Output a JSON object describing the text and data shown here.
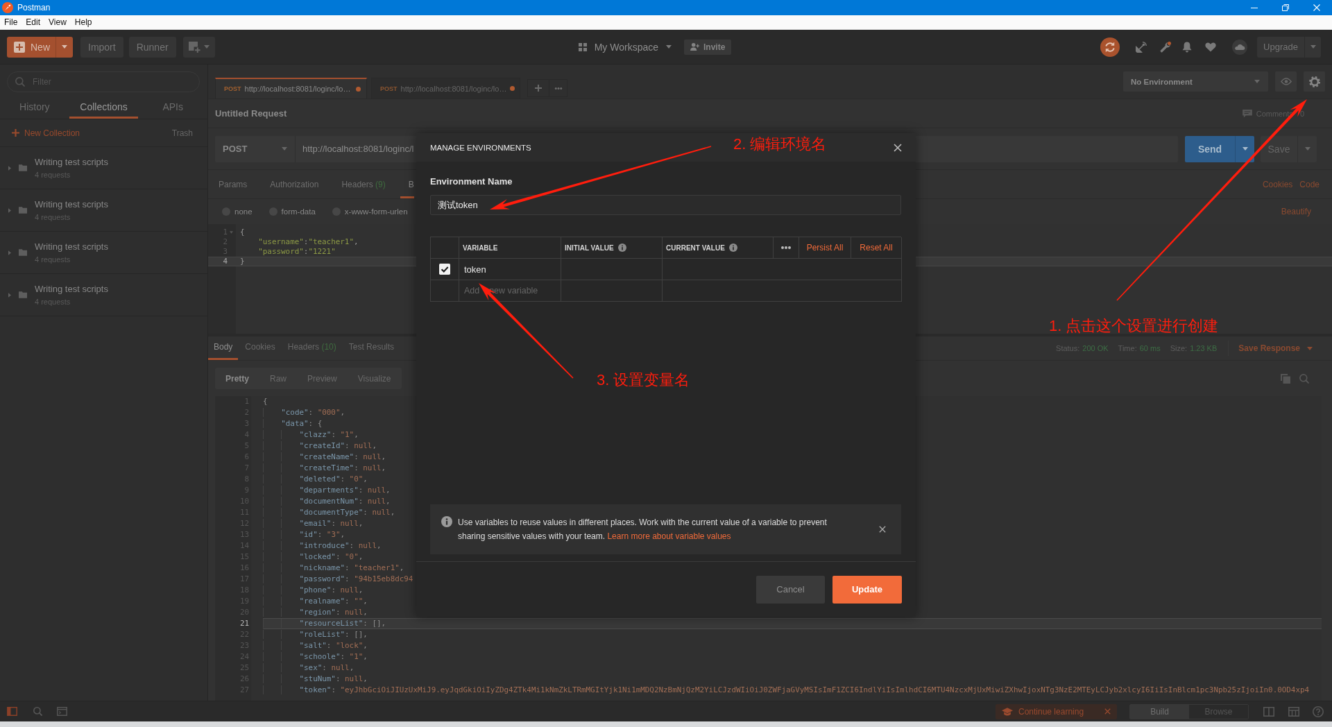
{
  "window": {
    "title": "Postman"
  },
  "menu": [
    {
      "label": "File"
    },
    {
      "label": "Edit"
    },
    {
      "label": "View"
    },
    {
      "label": "Help"
    }
  ],
  "toolbar": {
    "new": "New",
    "import": "Import",
    "runner": "Runner",
    "workspace": "My Workspace",
    "invite": "Invite",
    "upgrade": "Upgrade"
  },
  "sidebar": {
    "filter_placeholder": "Filter",
    "tabs": [
      {
        "label": "History",
        "selected": false
      },
      {
        "label": "Collections",
        "selected": true
      },
      {
        "label": "APIs",
        "selected": false
      }
    ],
    "new_collection": "New Collection",
    "trash": "Trash",
    "collections": [
      {
        "name": "Writing test scripts",
        "count": "4 requests"
      },
      {
        "name": "Writing test scripts",
        "count": "4 requests"
      },
      {
        "name": "Writing test scripts",
        "count": "4 requests"
      },
      {
        "name": "Writing test scripts",
        "count": "4 requests"
      }
    ]
  },
  "request_tabs": [
    {
      "method": "POST",
      "url": "http://localhost:8081/loginc/lo…",
      "unsaved": true,
      "selected": true
    },
    {
      "method": "POST",
      "url": "http://localhost:8081/loginc/lo…",
      "unsaved": true,
      "selected": false
    }
  ],
  "environment": {
    "value": "No Environment"
  },
  "request": {
    "title": "Untitled Request",
    "comments": "Comments",
    "comments_count": "0",
    "method": "POST",
    "url": "http://localhost:8081/loginc/l",
    "send": "Send",
    "save": "Save",
    "tabs": [
      {
        "label": "Params",
        "selected": false
      },
      {
        "label": "Authorization",
        "selected": false
      },
      {
        "label": "Headers",
        "count": "(9)",
        "selected": false
      },
      {
        "label": "B",
        "selected": true
      }
    ],
    "links": [
      {
        "label": "Cookies"
      },
      {
        "label": "Code"
      }
    ],
    "body_types": [
      {
        "label": "none",
        "selected": false
      },
      {
        "label": "form-data",
        "selected": false
      },
      {
        "label": "x-www-form-urlen",
        "selected": false
      }
    ],
    "beautify": "Beautify",
    "body_lines": [
      {
        "number": "1",
        "text": "{",
        "foldable": true,
        "selected": false
      },
      {
        "number": "2",
        "text": "    \"username\":\"teacher1\",",
        "foldable": false,
        "selected": false
      },
      {
        "number": "3",
        "text": "    \"password\":\"1221\"",
        "foldable": false,
        "selected": false
      },
      {
        "number": "4",
        "text": "}",
        "foldable": false,
        "selected": true
      }
    ]
  },
  "response": {
    "tabs": [
      {
        "label": "Body",
        "selected": true
      },
      {
        "label": "Cookies",
        "selected": false
      },
      {
        "label": "Headers",
        "count": "(10)",
        "selected": false
      },
      {
        "label": "Test Results",
        "selected": false
      }
    ],
    "status_label": "Status:",
    "status": "200 OK",
    "time_label": "Time:",
    "time": "60 ms",
    "size_label": "Size:",
    "size": "1.23 KB",
    "save_response": "Save Response",
    "views": [
      {
        "label": "Pretty",
        "selected": true
      },
      {
        "label": "Raw",
        "selected": false
      },
      {
        "label": "Preview",
        "selected": false
      },
      {
        "label": "Visualize",
        "selected": false
      }
    ],
    "lines": [
      {
        "number": "1",
        "text": "{",
        "selected": false
      },
      {
        "number": "2",
        "text": "    \"code\": \"000\",",
        "selected": false
      },
      {
        "number": "3",
        "text": "    \"data\": {",
        "selected": false
      },
      {
        "number": "4",
        "text": "        \"clazz\": \"1\",",
        "selected": false
      },
      {
        "number": "5",
        "text": "        \"createId\": null,",
        "selected": false
      },
      {
        "number": "6",
        "text": "        \"createName\": null,",
        "selected": false
      },
      {
        "number": "7",
        "text": "        \"createTime\": null,",
        "selected": false
      },
      {
        "number": "8",
        "text": "        \"deleted\": \"0\",",
        "selected": false
      },
      {
        "number": "9",
        "text": "        \"departments\": null,",
        "selected": false
      },
      {
        "number": "10",
        "text": "        \"documentNum\": null,",
        "selected": false
      },
      {
        "number": "11",
        "text": "        \"documentType\": null,",
        "selected": false
      },
      {
        "number": "12",
        "text": "        \"email\": null,",
        "selected": false
      },
      {
        "number": "13",
        "text": "        \"id\": \"3\",",
        "selected": false
      },
      {
        "number": "14",
        "text": "        \"introduce\": null,",
        "selected": false
      },
      {
        "number": "15",
        "text": "        \"locked\": \"0\",",
        "selected": false
      },
      {
        "number": "16",
        "text": "        \"nickname\": \"teacher1\",",
        "selected": false
      },
      {
        "number": "17",
        "text": "        \"password\": \"94b15eb8dc94",
        "selected": false
      },
      {
        "number": "18",
        "text": "        \"phone\": null,",
        "selected": false
      },
      {
        "number": "19",
        "text": "        \"realname\": \"\",",
        "selected": false
      },
      {
        "number": "20",
        "text": "        \"region\": null,",
        "selected": false
      },
      {
        "number": "21",
        "text": "        \"resourceList\": [],",
        "selected": true
      },
      {
        "number": "22",
        "text": "        \"roleList\": [],",
        "selected": false
      },
      {
        "number": "23",
        "text": "        \"salt\": \"lock\",",
        "selected": false
      },
      {
        "number": "24",
        "text": "        \"schoole\": \"1\",",
        "selected": false
      },
      {
        "number": "25",
        "text": "        \"sex\": null,",
        "selected": false
      },
      {
        "number": "26",
        "text": "        \"stuNum\": null,",
        "selected": false
      },
      {
        "number": "27",
        "text": "        \"token\": \"eyJhbGciOiJIUzUxMiJ9.eyJqdGkiOiIyZDg4ZTk4Mi1kNmZkLTRmMGItYjk1Ni1mMDQ2NzBmNjQzM2YiLCJzdWIiOiJ0ZWFjaGVyMSIsImF1ZCI6IndlYiIsImlhdCI6MTU4NzcxMjUxMiwiZXhwIjoxNTg3NzE2MTEyLCJyb2xlcyI6IiIsInBlcm1pc3Npb25zIjoiIn0.0OD4xp4",
        "selected": false
      }
    ]
  },
  "dialog": {
    "title": "MANAGE ENVIRONMENTS",
    "name_label": "Environment Name",
    "name_value": "测试token",
    "columns": [
      {
        "label": "VARIABLE",
        "info": false
      },
      {
        "label": "INITIAL VALUE",
        "info": true
      },
      {
        "label": "CURRENT VALUE",
        "info": true
      }
    ],
    "persist_all": "Persist All",
    "reset_all": "Reset All",
    "variables": [
      {
        "name": "token",
        "checked": true
      }
    ],
    "new_variable_placeholder": "Add    new variable",
    "info_text": "Use variables to reuse values in different places. Work with the current value of a variable to prevent sharing sensitive values with your team.",
    "info_link": "Learn more about variable values",
    "cancel": "Cancel",
    "update": "Update"
  },
  "status_bar": {
    "continue_learning": "Continue learning",
    "modes": [
      {
        "label": "Build",
        "selected": true
      },
      {
        "label": "Browse",
        "selected": false
      }
    ]
  },
  "annotations": [
    {
      "text": "1. 点击这个设置进行创建"
    },
    {
      "text": "2. 编辑环境名"
    },
    {
      "text": "3. 设置变量名"
    }
  ]
}
